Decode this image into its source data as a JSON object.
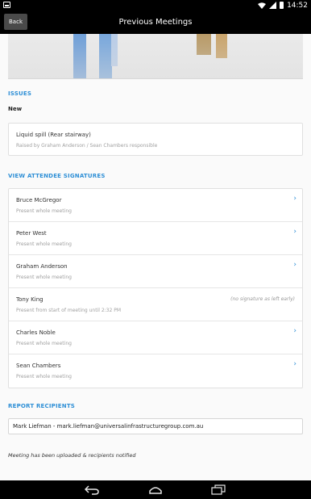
{
  "status_bar": {
    "time": "14:52"
  },
  "action_bar": {
    "back_label": "Back",
    "title": "Previous Meetings"
  },
  "issues": {
    "heading": "ISSUES",
    "status": "New",
    "item_title": "Liquid spill (Rear stairway)",
    "item_detail": "Raised by Graham Anderson / Sean Chambers responsible"
  },
  "signatures": {
    "heading": "VIEW ATTENDEE SIGNATURES",
    "attendees": [
      {
        "name": "Bruce McGregor",
        "attendance": "Present whole meeting"
      },
      {
        "name": "Peter West",
        "attendance": "Present whole meeting"
      },
      {
        "name": "Graham Anderson",
        "attendance": "Present whole meeting"
      },
      {
        "name": "Tony King",
        "attendance": "Present from start of meeting until 2:32 PM",
        "note": "(no signature as left early)"
      },
      {
        "name": "Charles Noble",
        "attendance": "Present whole meeting"
      },
      {
        "name": "Sean Chambers",
        "attendance": "Present whole meeting"
      }
    ]
  },
  "recipients": {
    "heading": "REPORT RECIPIENTS",
    "value": "Mark Liefman - mark.liefman@universalinfrastructuregroup.com.au"
  },
  "footer_note": "Meeting has been uploaded & recipients notified",
  "colors": {
    "accent": "#2e8fd6",
    "bar": "#000000"
  },
  "icons": {
    "chevron": "chevron-right-icon",
    "back": "back-arrow-icon",
    "home": "home-icon",
    "recents": "recents-icon"
  }
}
